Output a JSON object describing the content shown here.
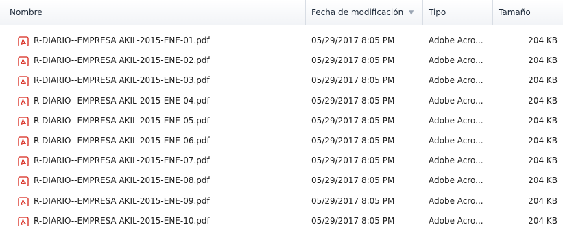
{
  "columns": {
    "name": "Nombre",
    "date": "Fecha de modificación",
    "type": "Tipo",
    "size": "Tamaño"
  },
  "files": [
    {
      "name": "R-DIARIO--EMPRESA AKIL-2015-ENE-01.pdf",
      "date": "05/29/2017 8:05 PM",
      "type": "Adobe Acro...",
      "size": "204 KB",
      "icon": "pdf-file-icon"
    },
    {
      "name": "R-DIARIO--EMPRESA AKIL-2015-ENE-02.pdf",
      "date": "05/29/2017 8:05 PM",
      "type": "Adobe Acro...",
      "size": "204 KB",
      "icon": "pdf-file-icon"
    },
    {
      "name": "R-DIARIO--EMPRESA AKIL-2015-ENE-03.pdf",
      "date": "05/29/2017 8:05 PM",
      "type": "Adobe Acro...",
      "size": "204 KB",
      "icon": "pdf-file-icon"
    },
    {
      "name": "R-DIARIO--EMPRESA AKIL-2015-ENE-04.pdf",
      "date": "05/29/2017 8:05 PM",
      "type": "Adobe Acro...",
      "size": "204 KB",
      "icon": "pdf-file-icon"
    },
    {
      "name": "R-DIARIO--EMPRESA AKIL-2015-ENE-05.pdf",
      "date": "05/29/2017 8:05 PM",
      "type": "Adobe Acro...",
      "size": "204 KB",
      "icon": "pdf-file-icon"
    },
    {
      "name": "R-DIARIO--EMPRESA AKIL-2015-ENE-06.pdf",
      "date": "05/29/2017 8:05 PM",
      "type": "Adobe Acro...",
      "size": "204 KB",
      "icon": "pdf-file-icon"
    },
    {
      "name": "R-DIARIO--EMPRESA AKIL-2015-ENE-07.pdf",
      "date": "05/29/2017 8:05 PM",
      "type": "Adobe Acro...",
      "size": "204 KB",
      "icon": "pdf-file-icon"
    },
    {
      "name": "R-DIARIO--EMPRESA AKIL-2015-ENE-08.pdf",
      "date": "05/29/2017 8:05 PM",
      "type": "Adobe Acro...",
      "size": "204 KB",
      "icon": "pdf-file-icon"
    },
    {
      "name": "R-DIARIO--EMPRESA AKIL-2015-ENE-09.pdf",
      "date": "05/29/2017 8:05 PM",
      "type": "Adobe Acro...",
      "size": "204 KB",
      "icon": "pdf-file-icon"
    },
    {
      "name": "R-DIARIO--EMPRESA AKIL-2015-ENE-10.pdf",
      "date": "05/29/2017 8:05 PM",
      "type": "Adobe Acro...",
      "size": "204 KB",
      "icon": "pdf-file-icon"
    }
  ],
  "colors": {
    "pdf_icon": "#d7261b",
    "header_border": "#d5dbe3"
  }
}
